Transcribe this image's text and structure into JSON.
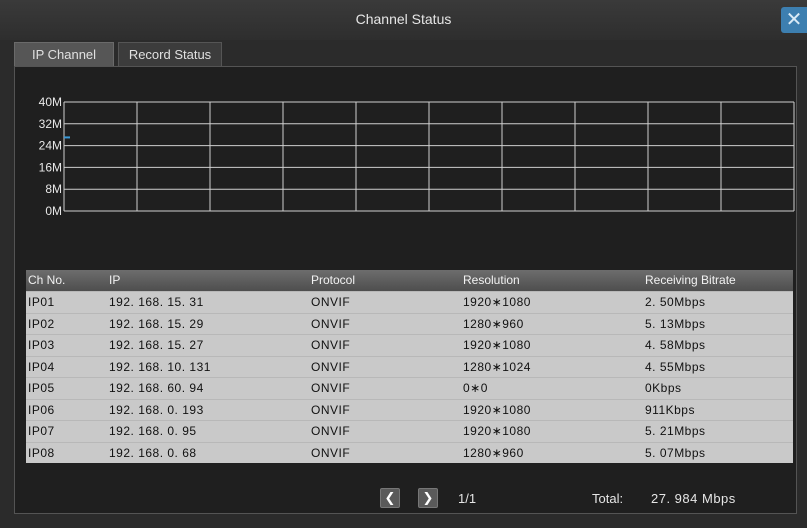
{
  "window": {
    "title": "Channel Status",
    "close_symbol": "✕"
  },
  "tabs": [
    {
      "label": "IP Channel",
      "active": true
    },
    {
      "label": "Record Status",
      "active": false
    }
  ],
  "chart_data": {
    "type": "line",
    "y_ticks": [
      "40M",
      "32M",
      "24M",
      "16M",
      "8M",
      "0M"
    ],
    "ylim": [
      0,
      40
    ],
    "x_divisions": 10,
    "grid": true,
    "series": [
      {
        "values": [
          27,
          27
        ]
      }
    ],
    "colors": {
      "grid": "#cfcfcf",
      "series": "#3a9ad9"
    }
  },
  "table": {
    "headers": [
      "Ch No.",
      "IP",
      "Protocol",
      "Resolution",
      "Receiving  Bitrate"
    ],
    "rows": [
      [
        "IP01",
        "192. 168. 15. 31",
        "ONVIF",
        "1920∗1080",
        "2. 50Mbps"
      ],
      [
        "IP02",
        "192. 168. 15. 29",
        "ONVIF",
        "1280∗960",
        "5. 13Mbps"
      ],
      [
        "IP03",
        "192. 168. 15. 27",
        "ONVIF",
        "1920∗1080",
        "4. 58Mbps"
      ],
      [
        "IP04",
        "192. 168. 10. 131",
        "ONVIF",
        "1280∗1024",
        "4. 55Mbps"
      ],
      [
        "IP05",
        "192. 168. 60. 94",
        "ONVIF",
        "0∗0",
        "0Kbps"
      ],
      [
        "IP06",
        "192. 168. 0. 193",
        "ONVIF",
        "1920∗1080",
        "911Kbps"
      ],
      [
        "IP07",
        "192. 168. 0. 95",
        "ONVIF",
        "1920∗1080",
        "5. 21Mbps"
      ],
      [
        "IP08",
        "192. 168. 0. 68",
        "ONVIF",
        "1280∗960",
        "5. 07Mbps"
      ]
    ]
  },
  "footer": {
    "prev_symbol": "❮",
    "next_symbol": "❯",
    "page": "1/1",
    "total_label": "Total:",
    "total_value": "27. 984  Mbps"
  }
}
